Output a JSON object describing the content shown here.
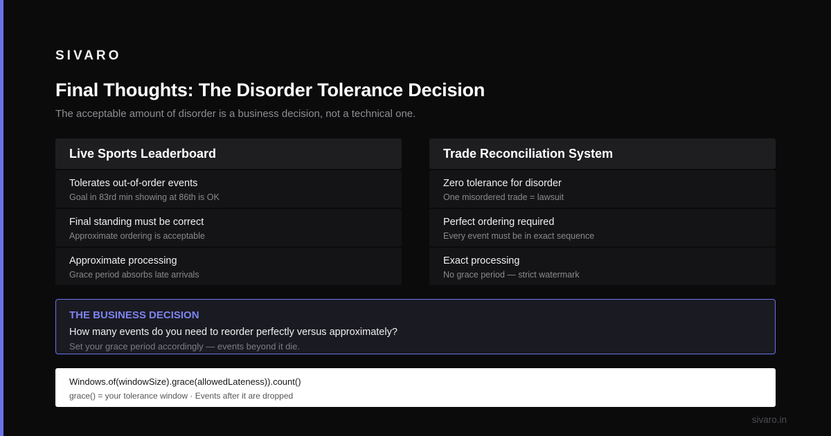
{
  "brand": "SIVARO",
  "title": "Final Thoughts: The Disorder Tolerance Decision",
  "subtitle": "The acceptable amount of disorder is a business decision, not a technical one.",
  "colors": {
    "accent": "#6b73e8",
    "background": "#0b0b0c",
    "accent_text": "#7d84f0"
  },
  "left": {
    "heading": "Live Sports Leaderboard",
    "rows": [
      {
        "main": "Tolerates out-of-order events",
        "sub": "Goal in 83rd min showing at 86th is OK"
      },
      {
        "main": "Final standing must be correct",
        "sub": "Approximate ordering is acceptable"
      },
      {
        "main": "Approximate processing",
        "sub": "Grace period absorbs late arrivals"
      }
    ]
  },
  "right": {
    "heading": "Trade Reconciliation System",
    "rows": [
      {
        "main": "Zero tolerance for disorder",
        "sub": "One misordered trade = lawsuit"
      },
      {
        "main": "Perfect ordering required",
        "sub": "Every event must be in exact sequence"
      },
      {
        "main": "Exact processing",
        "sub": "No grace period — strict watermark"
      }
    ]
  },
  "decision": {
    "label": "THE BUSINESS DECISION",
    "question": "How many events do you need to reorder perfectly versus approximately?",
    "note": "Set your grace period accordingly — events beyond it die."
  },
  "code": {
    "line": "Windows.of(windowSize).grace(allowedLateness)).count()",
    "hint": "grace() = your tolerance window · Events after it are dropped"
  },
  "footer": "sivaro.in"
}
